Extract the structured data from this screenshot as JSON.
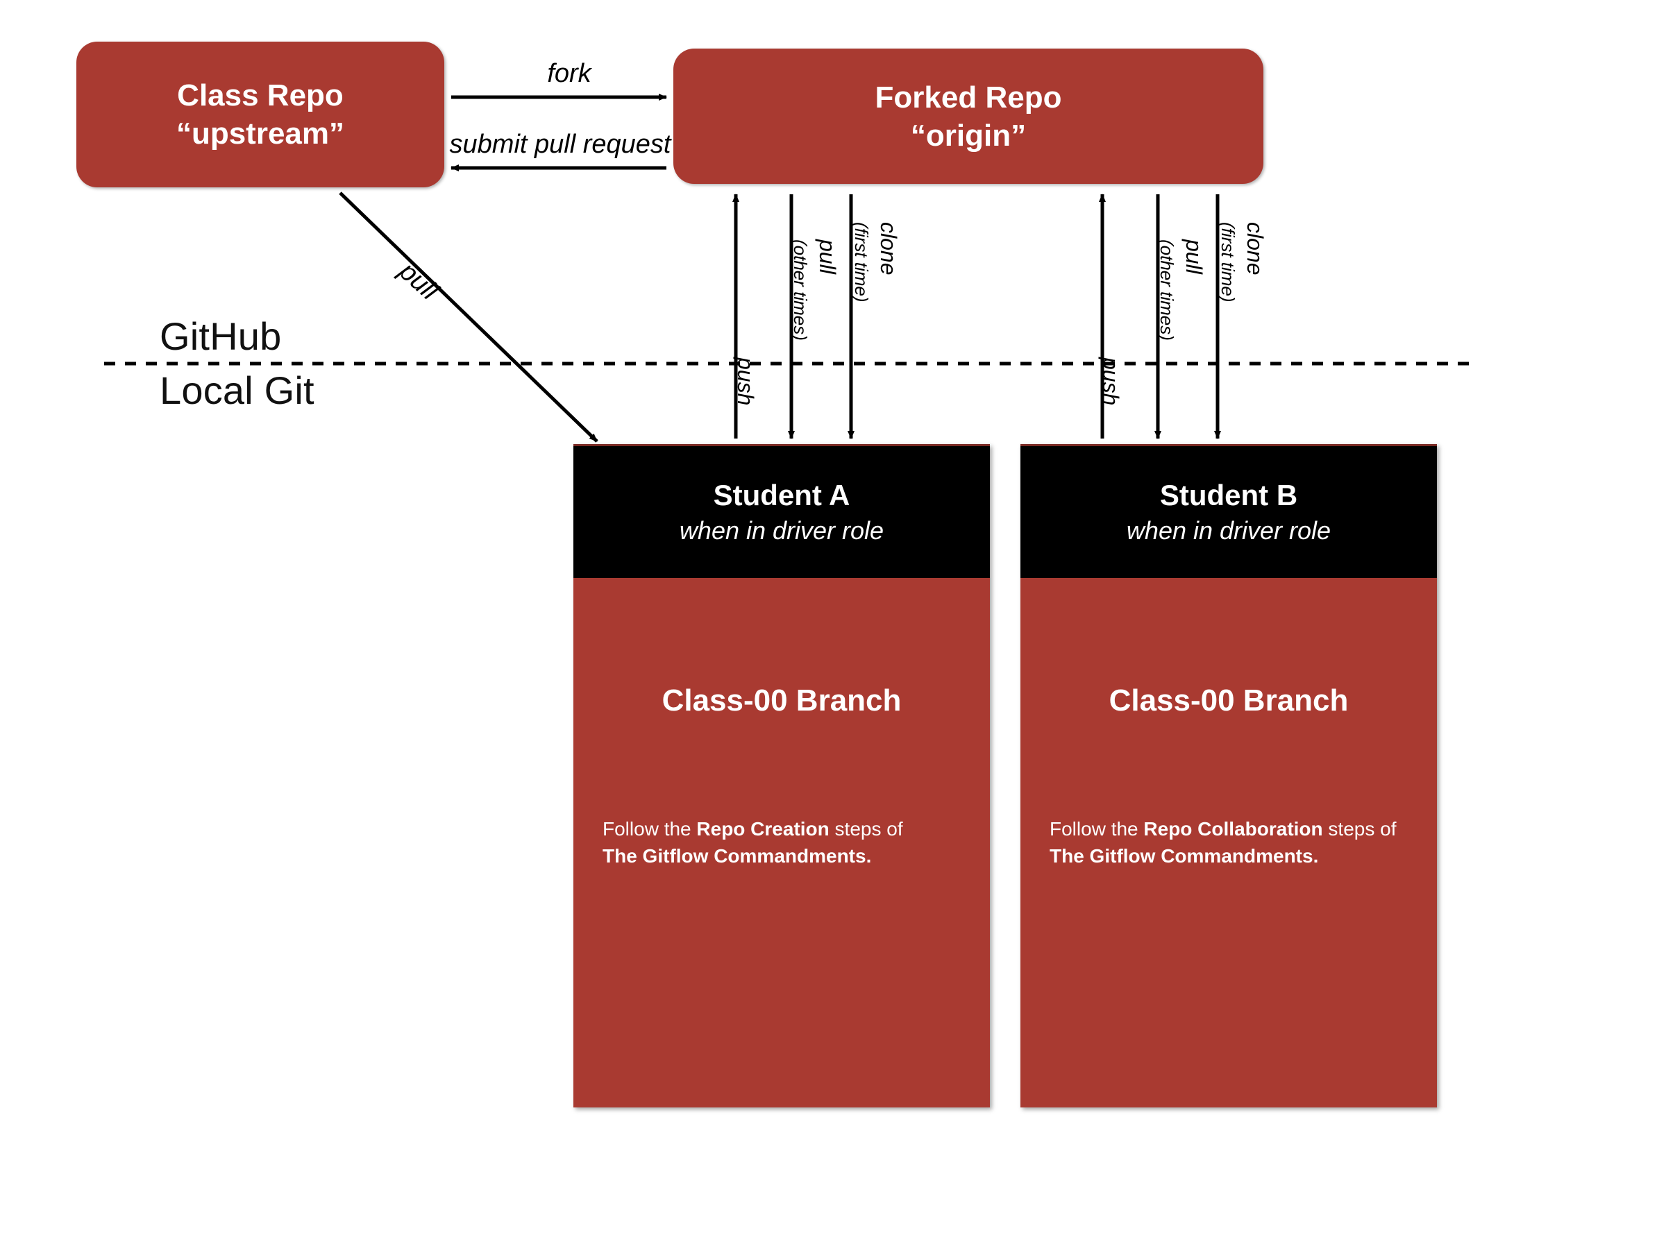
{
  "repos": {
    "class": {
      "line1": "Class Repo",
      "line2": "“upstream”"
    },
    "forked": {
      "line1": "Forked Repo",
      "line2": "“origin”"
    }
  },
  "arrows": {
    "fork": "fork",
    "submit_pr": "submit pull request",
    "pull_diag": "pull",
    "push": "push",
    "pull_vert": "pull",
    "pull_vert_note": "(other times)",
    "clone": "clone",
    "clone_note": "(first time)"
  },
  "zones": {
    "github": "GitHub",
    "local": "Local Git"
  },
  "cards": {
    "a": {
      "name": "Student A",
      "role": "when in driver role",
      "branch": "Class-00 Branch",
      "follow_pre": "Follow the ",
      "follow_bold1": "Repo Creation",
      "follow_mid": " steps of ",
      "follow_bold2": "The Gitflow Commandments."
    },
    "b": {
      "name": "Student B",
      "role": "when in driver role",
      "branch": "Class-00 Branch",
      "follow_pre": "Follow the ",
      "follow_bold1": "Repo Collaboration",
      "follow_mid": " steps of ",
      "follow_bold2": "The Gitflow Commandments."
    }
  }
}
